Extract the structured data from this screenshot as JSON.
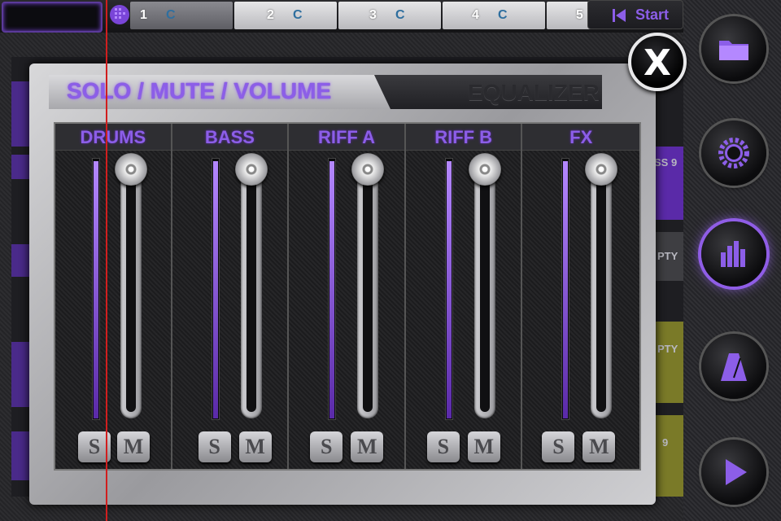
{
  "topbar": {
    "tabs": [
      {
        "num": "1",
        "key": "C"
      },
      {
        "num": "2",
        "key": "C"
      },
      {
        "num": "3",
        "key": "C"
      },
      {
        "num": "4",
        "key": "C"
      },
      {
        "num": "5",
        "key": ""
      }
    ],
    "start_label": "Start"
  },
  "background": {
    "right_labels": [
      "SS 9",
      "PTY",
      "PTY",
      "9"
    ]
  },
  "dialog": {
    "tab_solo_label": "SOLO / MUTE / VOLUME",
    "tab_eq_label": "EQUALIZER",
    "close_label": "X",
    "channels": [
      {
        "name": "DRUMS",
        "volume": 1.0,
        "solo_label": "S",
        "mute_label": "M"
      },
      {
        "name": "BASS",
        "volume": 1.0,
        "solo_label": "S",
        "mute_label": "M"
      },
      {
        "name": "RIFF A",
        "volume": 1.0,
        "solo_label": "S",
        "mute_label": "M"
      },
      {
        "name": "RIFF B",
        "volume": 1.0,
        "solo_label": "S",
        "mute_label": "M"
      },
      {
        "name": "FX",
        "volume": 1.0,
        "solo_label": "S",
        "mute_label": "M"
      }
    ]
  },
  "sidebar": {
    "buttons": [
      "folder-icon",
      "settings-gear-icon",
      "mixer-bars-icon",
      "metronome-icon",
      "play-icon"
    ],
    "active": "mixer-bars-icon"
  },
  "colors": {
    "accent": "#8c5ee8",
    "redline": "#d11e1e"
  }
}
